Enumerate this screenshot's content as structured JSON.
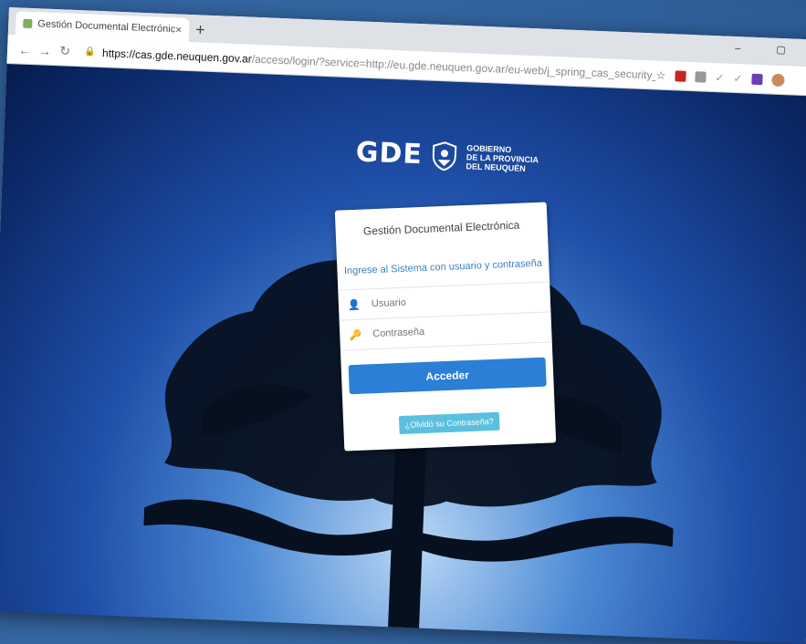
{
  "browser": {
    "tab_title": "Gestión Documental Electrónica",
    "tab_close": "×",
    "new_tab": "+",
    "window_controls": "– ▢",
    "url_host": "https://cas.gde.neuquen.gov.ar",
    "url_rest": "/acceso/login/?service=http://eu.gde.neuquen.gov.ar/eu-web/j_spring_cas_security_check"
  },
  "logo": {
    "text": "GDE",
    "gov_line1": "GOBIERNO",
    "gov_line2": "DE LA PROVINCIA",
    "gov_line3": "DEL NEUQUÉN"
  },
  "login": {
    "heading": "Gestión Documental Electrónica",
    "subheading": "Ingrese al Sistema con usuario y contraseña",
    "username_placeholder": "Usuario",
    "password_placeholder": "Contraseña",
    "submit_label": "Acceder",
    "forgot_label": "¿Olvidó su Contraseña?"
  },
  "colors": {
    "primary_button": "#2b7fd6",
    "info_button": "#5bc0de",
    "link_text": "#3c7fbf"
  }
}
